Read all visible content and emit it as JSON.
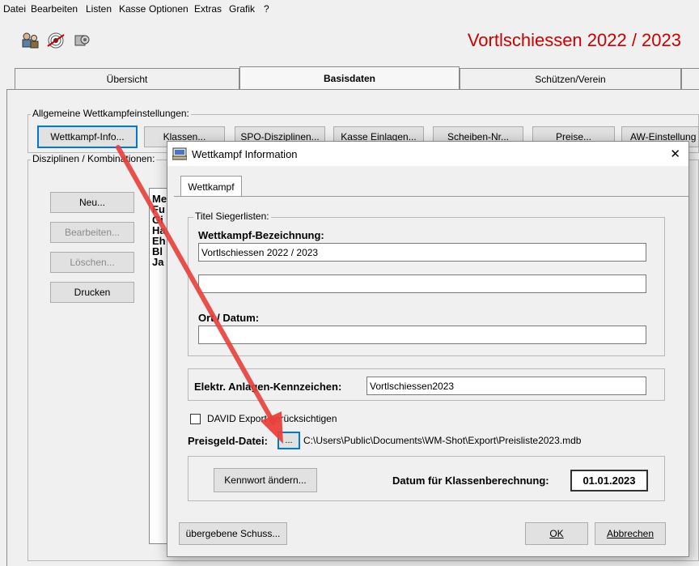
{
  "menu": [
    "Datei",
    "Bearbeiten",
    "Listen",
    "Kasse",
    "Optionen",
    "Extras",
    "Grafik",
    "?"
  ],
  "app_title": "Vortlschiessen 2022 / 2023",
  "tabs": [
    "Übersicht",
    "Basisdaten",
    "Schützen/Verein"
  ],
  "general": {
    "label": "Allgemeine Wettkampfeinstellungen:",
    "buttons": [
      "Wettkampf-Info...",
      "Klassen...",
      "SPO-Disziplinen...",
      "Kasse Einlagen...",
      "Scheiben-Nr...",
      "Preise...",
      "AW-Einstellung"
    ]
  },
  "disciplines": {
    "label": "Disziplinen / Kombinationen:",
    "buttons": [
      "Neu...",
      "Bearbeiten...",
      "Löschen...",
      "Drucken"
    ],
    "list_items": [
      "Me",
      "Fu",
      "Gi",
      "Ha",
      "Eh",
      "Bl",
      "Ja"
    ]
  },
  "dialog": {
    "title": "Wettkampf Information",
    "close": "✕",
    "tab": "Wettkampf",
    "titel_group": "Titel Siegerlisten:",
    "bezeichnung_label": "Wettkampf-Bezeichnung:",
    "bezeichnung_value": "Vortlschiessen 2022 / 2023",
    "bezeichnung2_value": "",
    "ort_label": "Ort / Datum:",
    "ort_value": "",
    "kennzeichen_label": "Elektr. Anlagen-Kennzeichen:",
    "kennzeichen_value": "Vortlschiessen2023",
    "david_label": "DAVID Export berücksichtigen",
    "david_checked": false,
    "preisgeld_label": "Preisgeld-Datei:",
    "browse_label": "...",
    "preisgeld_path": "C:\\Users\\Public\\Documents\\WM-Shot\\Export\\Preisliste2023.mdb",
    "kennwort_button": "Kennwort ändern...",
    "datum_label": "Datum für Klassenberechnung:",
    "datum_value": "01.01.2023",
    "schuss_button": "übergebene Schuss...",
    "ok_button": "OK",
    "abbrechen_button": "Abbrechen"
  },
  "colors": {
    "title_red": "#cc0000",
    "arrow_red": "#e8403a",
    "focus_blue": "#0078d7"
  }
}
